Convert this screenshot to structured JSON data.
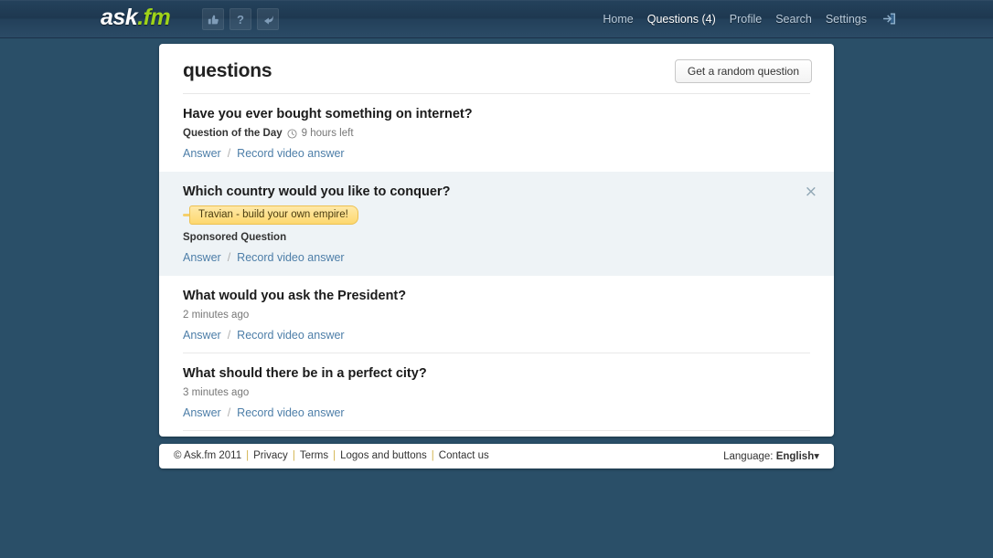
{
  "header": {
    "logo_main": "ask",
    "logo_suffix": ".fm",
    "icons": [
      {
        "name": "thumbs-up-icon",
        "glyph": "👍"
      },
      {
        "name": "question-mark-icon",
        "glyph": "?"
      },
      {
        "name": "reply-arrow-icon",
        "glyph": "↵"
      }
    ],
    "nav": [
      {
        "label": "Home",
        "active": false
      },
      {
        "label": "Questions (4)",
        "active": true
      },
      {
        "label": "Profile",
        "active": false
      },
      {
        "label": "Search",
        "active": false
      },
      {
        "label": "Settings",
        "active": false
      }
    ],
    "logout_icon": "logout-icon"
  },
  "main": {
    "title": "questions",
    "random_button": "Get a random question",
    "questions": [
      {
        "title": "Have you ever bought something on internet?",
        "meta_label": "Question of the Day",
        "has_clock": true,
        "meta_time": "9 hours left",
        "answer_label": "Answer",
        "separator": "/",
        "video_label": "Record video answer",
        "sponsored": false
      },
      {
        "title": "Which country would you like to conquer?",
        "ad_text": "Travian - build your own empire!",
        "meta_label": "Sponsored Question",
        "has_clock": false,
        "meta_time": "",
        "answer_label": "Answer",
        "separator": "/",
        "video_label": "Record video answer",
        "sponsored": true,
        "close_label": "×"
      },
      {
        "title": "What would you ask the President?",
        "meta_label": "",
        "has_clock": false,
        "meta_time": "2 minutes ago",
        "answer_label": "Answer",
        "separator": "/",
        "video_label": "Record video answer",
        "sponsored": false
      },
      {
        "title": "What should there be in a perfect city?",
        "meta_label": "",
        "has_clock": false,
        "meta_time": "3 minutes ago",
        "answer_label": "Answer",
        "separator": "/",
        "video_label": "Record video answer",
        "sponsored": false
      }
    ]
  },
  "footer": {
    "copyright": "© Ask.fm 2011",
    "links": [
      "Privacy",
      "Terms",
      "Logos and buttons",
      "Contact us"
    ],
    "separator": "|",
    "language_label": "Language:",
    "language_value": "English",
    "language_caret": "▾"
  },
  "colors": {
    "page_bg": "#2a4f68",
    "header_bg": "#1e3850",
    "accent_green": "#9fd319",
    "link_blue": "#4d7ea8",
    "sponsored_bg": "#eef3f6",
    "badge_yellow": "#fdd86f"
  }
}
